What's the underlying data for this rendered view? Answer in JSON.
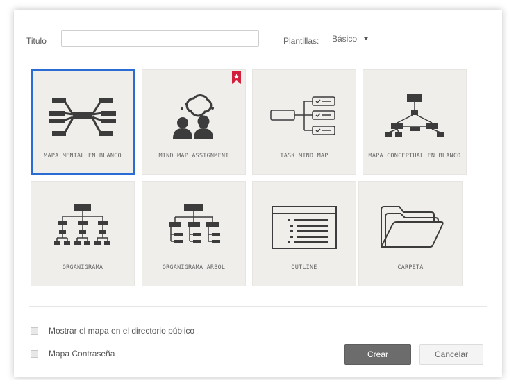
{
  "form": {
    "title_label": "Titulo",
    "title_value": "",
    "title_placeholder": "",
    "templates_label": "Plantillas:",
    "templates_selected": "Básico"
  },
  "templates": [
    {
      "label": "MAPA MENTAL EN BLANCO",
      "icon": "blank-mind-map-icon",
      "selected": true
    },
    {
      "label": "MIND MAP ASSIGNMENT",
      "icon": "assignment-people-icon",
      "badge": "star-bookmark-icon"
    },
    {
      "label": "TASK MIND MAP",
      "icon": "task-checklist-icon"
    },
    {
      "label": "MAPA CONCEPTUAL EN BLANCO",
      "icon": "concept-map-icon"
    },
    {
      "label": "ORGANIGRAMA",
      "icon": "org-chart-icon"
    },
    {
      "label": "ORGANIGRAMA ARBOL",
      "icon": "org-tree-icon"
    },
    {
      "label": "OUTLINE",
      "icon": "outline-list-icon"
    },
    {
      "label": "CARPETA",
      "icon": "folder-icon"
    }
  ],
  "options": {
    "public_directory_label": "Mostrar el mapa en el directorio público",
    "password_label": "Mapa Contraseña"
  },
  "buttons": {
    "create_label": "Crear",
    "cancel_label": "Cancelar"
  },
  "colors": {
    "selected_border": "#2b6cd4",
    "tile_background": "#efeeeb",
    "icon_dark": "#3c3c3c",
    "badge_red": "#d21f3c",
    "create_button": "#6c6c6c"
  }
}
